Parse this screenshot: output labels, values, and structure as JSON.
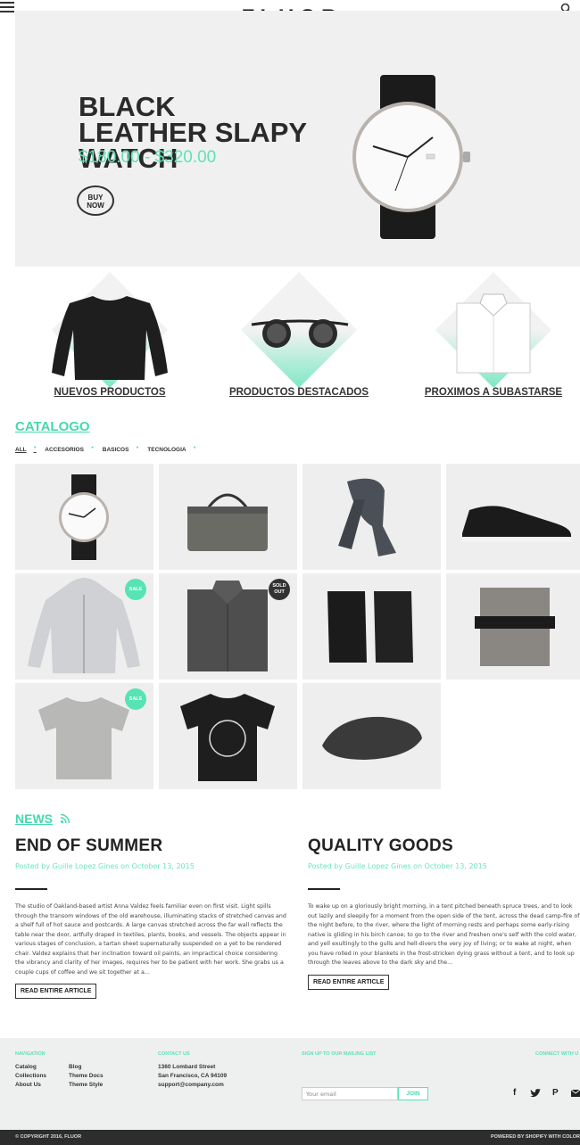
{
  "header": {
    "logo": "FLUOR"
  },
  "hero": {
    "title": "BLACK LEATHER SLAPY WATCH",
    "price": "$180.00 - $320.00",
    "button": "BUY NOW"
  },
  "categories": [
    {
      "label": "NUEVOS PRODUCTOS"
    },
    {
      "label": "PRODUCTOS DESTACADOS"
    },
    {
      "label": "PROXIMOS A SUBASTARSE"
    }
  ],
  "catalog": {
    "title": "CATALOGO",
    "filters": [
      "ALL",
      "ACCESORIOS",
      "BASICOS",
      "TECNOLOGIA"
    ],
    "badges": {
      "sale": "SALE",
      "sold_out": "SOLD OUT"
    }
  },
  "news": {
    "title": "NEWS",
    "articles": [
      {
        "title": "END OF SUMMER",
        "byline": "Posted by Guille Lopez Gines on October 13, 2015",
        "body": "The studio of Oakland-based artist Anna Valdez feels familiar even on first visit. Light spills through the transom windows of the old warehouse, illuminating stacks of stretched canvas and a shelf full of hot sauce and postcards. A large canvas stretched across the far wall reflects the table near the door, artfully draped in textiles, plants, books, and vessels. The objects appear in various stages of conclusion, a tartan sheet supernaturally suspended on a yet to be rendered chair. Valdez explains that her inclination toward oil paints, an impractical choice considering the vibrancy and clarity of her images, requires her to be patient with her work. She grabs us a couple cups of coffee and we sit together at a...",
        "button": "READ ENTIRE ARTICLE"
      },
      {
        "title": "QUALITY GOODS",
        "byline": "Posted by Guille Lopez Gines on October 13, 2015",
        "body": "To wake up on a gloriously bright morning, in a tent pitched beneath spruce trees, and to look out lazily and sleepily for a moment from the open side of the tent, across the dead camp-fire of the night before, to the river, where the light of morning rests and perhaps some early-rising native is gliding in his birch canoe; to go to the river and freshen one's self with the cold water, and yell exultingly to the gulls and hell-divers the very joy of living; or to wake at night, when you have rolled in your blankets in the frost-stricken dying grass without a tent, and to look up through the leaves above to the dark sky and the...",
        "button": "READ ENTIRE ARTICLE"
      }
    ]
  },
  "footer": {
    "nav_heading": "NAVIGATION",
    "nav_col1": [
      "Catalog",
      "Collections",
      "About Us"
    ],
    "nav_col2": [
      "Blog",
      "Theme Docs",
      "Theme Style"
    ],
    "contact_heading": "CONTACT US",
    "contact": [
      "1360 Lombard Street",
      "San Francisco, CA 94109",
      "support@company.com"
    ],
    "signup_heading": "SIGN UP TO OUR MAILING LIST",
    "email_placeholder": "Your email",
    "join": "JOIN",
    "connect_heading": "CONNECT WITH U",
    "copyright": "© COPYRIGHT 2016, FLUOR",
    "powered": "POWERED BY SHOPIFY WITH COLOR"
  },
  "colors": {
    "accent": "#58e3b4",
    "hero_bg": "#f0f0f0",
    "footer_bg": "#eef0ef",
    "bottom_bar": "#2d2d2d"
  }
}
